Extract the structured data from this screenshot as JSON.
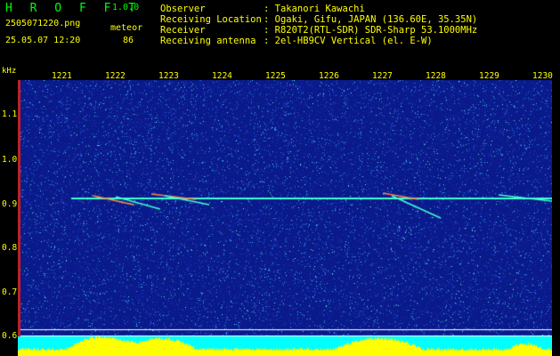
{
  "app": {
    "title": "H R O F F T",
    "version": "1.0.0"
  },
  "capture": {
    "filename": "2505071220.png",
    "meteor_label": "meteor",
    "datetime": "25.05.07 12:20",
    "meteor_count": "86"
  },
  "info": [
    {
      "key": "Observer",
      "value": ": Takanori Kawachi"
    },
    {
      "key": "Receiving Location",
      "value": ": Ogaki, Gifu, JAPAN (136.60E, 35.35N)"
    },
    {
      "key": "Receiver",
      "value": ": R820T2(RTL-SDR) SDR-Sharp 53.1000MHz"
    },
    {
      "key": "Receiving antenna",
      "value": ": 2el-HB9CV Vertical (el. E-W)"
    }
  ],
  "axes": {
    "y_unit": "kHz",
    "x_ticks": [
      "1221",
      "1222",
      "1223",
      "1224",
      "1225",
      "1226",
      "1227",
      "1228",
      "1229",
      "1230"
    ],
    "y_ticks": [
      "1.1",
      "1.0",
      "0.9",
      "0.8",
      "0.7",
      "0.6"
    ],
    "y_range": [
      0.575,
      1.16
    ]
  },
  "colors": {
    "background": "#0a1a8a",
    "signal": "#40ffd0",
    "text": "#ffff00",
    "title": "#00ff00",
    "level": "#ffff00",
    "floor": "#00ffff"
  }
}
